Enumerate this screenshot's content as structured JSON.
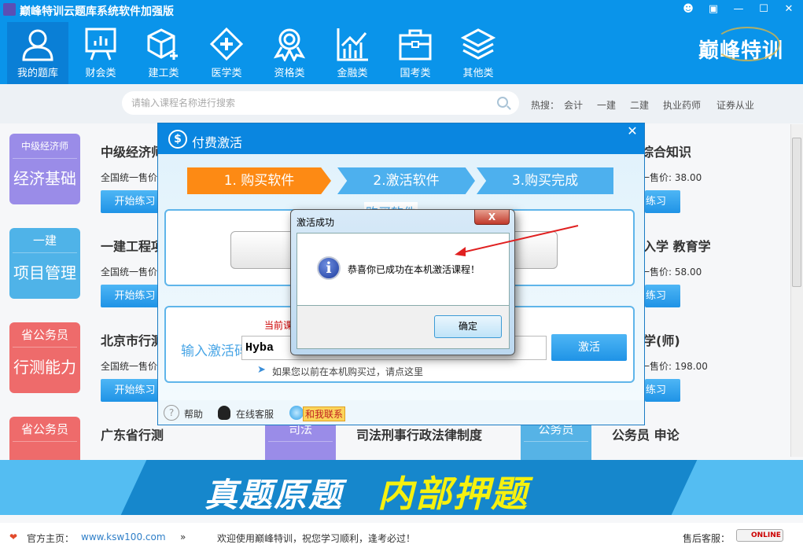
{
  "app": {
    "title": "巅峰特训云题库系统软件加强版",
    "brand": "巅峰特训"
  },
  "window_controls": [
    "user-icon",
    "menu-icon",
    "minimize-icon",
    "maximize-icon",
    "close-icon"
  ],
  "nav": [
    {
      "label": "我的题库",
      "icon": "user-icon",
      "active": true
    },
    {
      "label": "财会类",
      "icon": "presentation-chart-icon"
    },
    {
      "label": "建工类",
      "icon": "cube-plus-icon"
    },
    {
      "label": "医学类",
      "icon": "medical-cross-icon"
    },
    {
      "label": "资格类",
      "icon": "award-ribbon-icon"
    },
    {
      "label": "金融类",
      "icon": "bar-chart-trend-icon"
    },
    {
      "label": "国考类",
      "icon": "briefcase-icon"
    },
    {
      "label": "其他类",
      "icon": "layers-icon"
    }
  ],
  "search": {
    "placeholder": "请输入课程名称进行搜索",
    "hot_label": "热搜：",
    "hot": [
      "会计",
      "一建",
      "二建",
      "执业药师",
      "证券从业"
    ]
  },
  "cards": {
    "col1": [
      {
        "tile_top": "中级经济师",
        "tile_main": "经济基础",
        "title": "中级经济师",
        "price": "全国统一售价",
        "button": "开始练习",
        "color": "#9a8ce8"
      },
      {
        "tile_top": "一建",
        "tile_main": "项目管理",
        "title": "一建工程项",
        "price": "全国统一售价",
        "button": "开始练习",
        "color": "#4fb3e8"
      },
      {
        "tile_top": "省公务员",
        "tile_main": "行测能力",
        "title": "北京市行测",
        "price": "全国统一售价",
        "button": "开始练习",
        "color": "#ee6b6b"
      },
      {
        "tile_top": "省公务员",
        "title": "广东省行测",
        "color": "#ee6b6b"
      }
    ],
    "col2": [
      {
        "tile_top": "司法",
        "title": "司法刑事行政法律制度",
        "color": "#9a8ce8"
      }
    ],
    "col3": [
      {
        "title": "综合知识",
        "price": "一售价:  38.00",
        "button": "练习"
      },
      {
        "title": "入学  教育学",
        "price": "一售价:  58.00",
        "button": "练习"
      },
      {
        "title": "学(师)",
        "price": "一售价:  198.00",
        "button": "练习"
      },
      {
        "tile_top": "公务员",
        "title": "公务员  申论",
        "color": "#56b3e6"
      }
    ]
  },
  "banner": {
    "text_white": "真题原题",
    "text_yellow": "内部押题"
  },
  "footer": {
    "home_label": "官方主页：",
    "home_url": "www.ksw100.com",
    "welcome": "欢迎使用巅峰特训，祝您学习顺利，逢考必过！",
    "service_label": "售后客服：",
    "online": "ONLINE"
  },
  "dialog": {
    "title": "付费激活",
    "steps": [
      "1. 购买软件",
      "2.激活软件",
      "3.购买完成"
    ],
    "active_step": 1,
    "section_label": "购买软件",
    "current_course": "当前课",
    "code_label": "输入激活码:",
    "code_value": "Hyba",
    "activate": "激活",
    "link": "如果您以前在本机购买过，请点这里",
    "help": "帮助",
    "online_service": "在线客服",
    "contact": "和我联系",
    "colors": {
      "active_step": "#fd8a14",
      "step": "#4db0ee"
    }
  },
  "msgbox": {
    "title": "激活成功",
    "message": "恭喜你已成功在本机激活课程！",
    "ok": "确定",
    "icon": "info-icon"
  },
  "annotation": {
    "arrow_color": "#e02020"
  }
}
